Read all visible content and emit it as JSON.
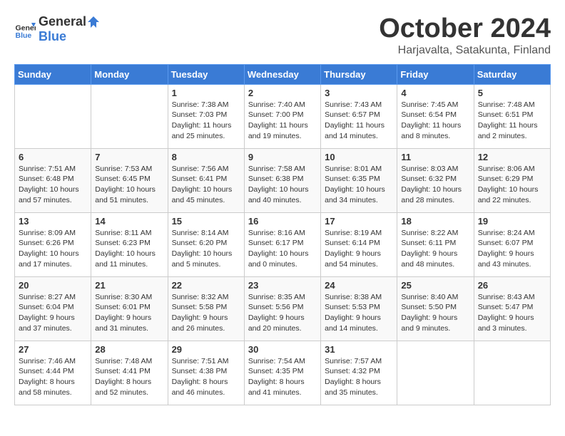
{
  "header": {
    "logo_general": "General",
    "logo_blue": "Blue",
    "month": "October 2024",
    "location": "Harjavalta, Satakunta, Finland"
  },
  "days_of_week": [
    "Sunday",
    "Monday",
    "Tuesday",
    "Wednesday",
    "Thursday",
    "Friday",
    "Saturday"
  ],
  "weeks": [
    [
      {
        "day": "",
        "details": ""
      },
      {
        "day": "",
        "details": ""
      },
      {
        "day": "1",
        "details": "Sunrise: 7:38 AM\nSunset: 7:03 PM\nDaylight: 11 hours\nand 25 minutes."
      },
      {
        "day": "2",
        "details": "Sunrise: 7:40 AM\nSunset: 7:00 PM\nDaylight: 11 hours\nand 19 minutes."
      },
      {
        "day": "3",
        "details": "Sunrise: 7:43 AM\nSunset: 6:57 PM\nDaylight: 11 hours\nand 14 minutes."
      },
      {
        "day": "4",
        "details": "Sunrise: 7:45 AM\nSunset: 6:54 PM\nDaylight: 11 hours\nand 8 minutes."
      },
      {
        "day": "5",
        "details": "Sunrise: 7:48 AM\nSunset: 6:51 PM\nDaylight: 11 hours\nand 2 minutes."
      }
    ],
    [
      {
        "day": "6",
        "details": "Sunrise: 7:51 AM\nSunset: 6:48 PM\nDaylight: 10 hours\nand 57 minutes."
      },
      {
        "day": "7",
        "details": "Sunrise: 7:53 AM\nSunset: 6:45 PM\nDaylight: 10 hours\nand 51 minutes."
      },
      {
        "day": "8",
        "details": "Sunrise: 7:56 AM\nSunset: 6:41 PM\nDaylight: 10 hours\nand 45 minutes."
      },
      {
        "day": "9",
        "details": "Sunrise: 7:58 AM\nSunset: 6:38 PM\nDaylight: 10 hours\nand 40 minutes."
      },
      {
        "day": "10",
        "details": "Sunrise: 8:01 AM\nSunset: 6:35 PM\nDaylight: 10 hours\nand 34 minutes."
      },
      {
        "day": "11",
        "details": "Sunrise: 8:03 AM\nSunset: 6:32 PM\nDaylight: 10 hours\nand 28 minutes."
      },
      {
        "day": "12",
        "details": "Sunrise: 8:06 AM\nSunset: 6:29 PM\nDaylight: 10 hours\nand 22 minutes."
      }
    ],
    [
      {
        "day": "13",
        "details": "Sunrise: 8:09 AM\nSunset: 6:26 PM\nDaylight: 10 hours\nand 17 minutes."
      },
      {
        "day": "14",
        "details": "Sunrise: 8:11 AM\nSunset: 6:23 PM\nDaylight: 10 hours\nand 11 minutes."
      },
      {
        "day": "15",
        "details": "Sunrise: 8:14 AM\nSunset: 6:20 PM\nDaylight: 10 hours\nand 5 minutes."
      },
      {
        "day": "16",
        "details": "Sunrise: 8:16 AM\nSunset: 6:17 PM\nDaylight: 10 hours\nand 0 minutes."
      },
      {
        "day": "17",
        "details": "Sunrise: 8:19 AM\nSunset: 6:14 PM\nDaylight: 9 hours\nand 54 minutes."
      },
      {
        "day": "18",
        "details": "Sunrise: 8:22 AM\nSunset: 6:11 PM\nDaylight: 9 hours\nand 48 minutes."
      },
      {
        "day": "19",
        "details": "Sunrise: 8:24 AM\nSunset: 6:07 PM\nDaylight: 9 hours\nand 43 minutes."
      }
    ],
    [
      {
        "day": "20",
        "details": "Sunrise: 8:27 AM\nSunset: 6:04 PM\nDaylight: 9 hours\nand 37 minutes."
      },
      {
        "day": "21",
        "details": "Sunrise: 8:30 AM\nSunset: 6:01 PM\nDaylight: 9 hours\nand 31 minutes."
      },
      {
        "day": "22",
        "details": "Sunrise: 8:32 AM\nSunset: 5:58 PM\nDaylight: 9 hours\nand 26 minutes."
      },
      {
        "day": "23",
        "details": "Sunrise: 8:35 AM\nSunset: 5:56 PM\nDaylight: 9 hours\nand 20 minutes."
      },
      {
        "day": "24",
        "details": "Sunrise: 8:38 AM\nSunset: 5:53 PM\nDaylight: 9 hours\nand 14 minutes."
      },
      {
        "day": "25",
        "details": "Sunrise: 8:40 AM\nSunset: 5:50 PM\nDaylight: 9 hours\nand 9 minutes."
      },
      {
        "day": "26",
        "details": "Sunrise: 8:43 AM\nSunset: 5:47 PM\nDaylight: 9 hours\nand 3 minutes."
      }
    ],
    [
      {
        "day": "27",
        "details": "Sunrise: 7:46 AM\nSunset: 4:44 PM\nDaylight: 8 hours\nand 58 minutes."
      },
      {
        "day": "28",
        "details": "Sunrise: 7:48 AM\nSunset: 4:41 PM\nDaylight: 8 hours\nand 52 minutes."
      },
      {
        "day": "29",
        "details": "Sunrise: 7:51 AM\nSunset: 4:38 PM\nDaylight: 8 hours\nand 46 minutes."
      },
      {
        "day": "30",
        "details": "Sunrise: 7:54 AM\nSunset: 4:35 PM\nDaylight: 8 hours\nand 41 minutes."
      },
      {
        "day": "31",
        "details": "Sunrise: 7:57 AM\nSunset: 4:32 PM\nDaylight: 8 hours\nand 35 minutes."
      },
      {
        "day": "",
        "details": ""
      },
      {
        "day": "",
        "details": ""
      }
    ]
  ]
}
